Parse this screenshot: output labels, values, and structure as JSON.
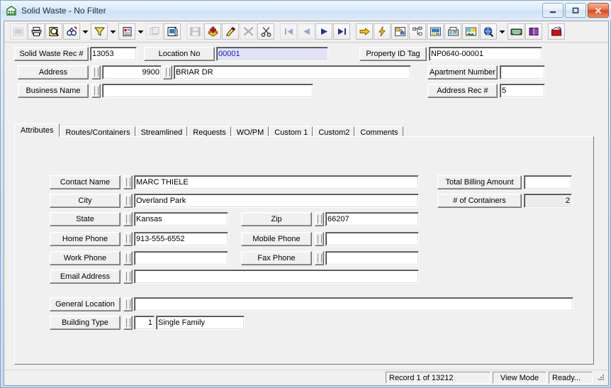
{
  "window": {
    "title": "Solid Waste - No Filter",
    "icon": "building-icon",
    "controls": {
      "minimize": "Minimize",
      "maximize": "Maximize",
      "close": "Close"
    }
  },
  "toolbar": {
    "buttons": [
      {
        "name": "grid-view-icon",
        "tooltip": "Grid View",
        "disabled": true
      },
      {
        "name": "print-icon",
        "tooltip": "Print",
        "disabled": false
      },
      {
        "name": "print-preview-icon",
        "tooltip": "Print Preview",
        "disabled": false
      },
      {
        "name": "find-icon",
        "tooltip": "Find",
        "disabled": false
      },
      {
        "name": "find-dropdown-icon",
        "tooltip": "Find Options",
        "disabled": false
      },
      {
        "name": "filter-icon",
        "tooltip": "Filter",
        "disabled": false
      },
      {
        "name": "filter-dropdown-icon",
        "tooltip": "Filter Options",
        "disabled": false
      },
      {
        "name": "report-icon",
        "tooltip": "Reports",
        "disabled": false
      },
      {
        "name": "report-dropdown-icon",
        "tooltip": "Report Options",
        "disabled": false
      },
      {
        "name": "properties-icon",
        "tooltip": "Properties",
        "disabled": true
      },
      {
        "name": "refresh-icon",
        "tooltip": "Refresh",
        "disabled": false
      },
      {
        "name": "save-icon",
        "tooltip": "Save",
        "disabled": true
      },
      {
        "name": "add-record-icon",
        "tooltip": "Add Record",
        "disabled": false
      },
      {
        "name": "edit-record-icon",
        "tooltip": "Edit Record",
        "disabled": false
      },
      {
        "name": "delete-record-icon",
        "tooltip": "Delete Record",
        "disabled": true
      },
      {
        "name": "cut-icon",
        "tooltip": "Cut",
        "disabled": false
      },
      {
        "name": "first-record-icon",
        "tooltip": "First Record",
        "disabled": true
      },
      {
        "name": "previous-record-icon",
        "tooltip": "Previous Record",
        "disabled": true
      },
      {
        "name": "next-record-icon",
        "tooltip": "Next Record",
        "disabled": false
      },
      {
        "name": "last-record-icon",
        "tooltip": "Last Record",
        "disabled": false
      },
      {
        "name": "go-to-icon",
        "tooltip": "Go To",
        "disabled": false
      },
      {
        "name": "quick-action-icon",
        "tooltip": "Quick Action",
        "disabled": false
      },
      {
        "name": "workflow-icon",
        "tooltip": "Workflow",
        "disabled": false
      },
      {
        "name": "hierarchy-icon",
        "tooltip": "Hierarchy",
        "disabled": false
      },
      {
        "name": "screen-icon",
        "tooltip": "Screen",
        "disabled": false
      },
      {
        "name": "fax-icon",
        "tooltip": "Fax",
        "disabled": false
      },
      {
        "name": "image-icon",
        "tooltip": "Image",
        "disabled": false
      },
      {
        "name": "globe-search-icon",
        "tooltip": "Web Search",
        "disabled": false
      },
      {
        "name": "globe-dropdown-icon",
        "tooltip": "Web Options",
        "disabled": false
      },
      {
        "name": "keyboard-icon",
        "tooltip": "Keyboard",
        "disabled": false
      },
      {
        "name": "help-book-icon",
        "tooltip": "Help",
        "disabled": false
      },
      {
        "name": "exit-icon",
        "tooltip": "Exit",
        "disabled": false
      }
    ]
  },
  "header": {
    "rec_no_label": "Solid Waste Rec #",
    "rec_no_value": "13053",
    "location_no_label": "Location No",
    "location_no_value": "00001",
    "property_id_label": "Property ID Tag",
    "property_id_value": "NP0640-00001",
    "address_label": "Address",
    "address_number": "9900",
    "address_street": "BRIAR DR",
    "apartment_label": "Apartment Number",
    "apartment_value": "",
    "business_name_label": "Business Name",
    "business_name_value": "",
    "address_rec_label": "Address Rec #",
    "address_rec_value": "5"
  },
  "tabs": [
    {
      "label": "Attributes",
      "active": true
    },
    {
      "label": "Routes/Containers",
      "active": false
    },
    {
      "label": "Streamlined",
      "active": false
    },
    {
      "label": "Requests",
      "active": false
    },
    {
      "label": "WO/PM",
      "active": false
    },
    {
      "label": "Custom 1",
      "active": false
    },
    {
      "label": "Custom2",
      "active": false
    },
    {
      "label": "Comments",
      "active": false
    }
  ],
  "attributes": {
    "contact_name_label": "Contact Name",
    "contact_name_value": "MARC THIELE",
    "city_label": "City",
    "city_value": "Overland Park",
    "state_label": "State",
    "state_value": "Kansas",
    "zip_label": "Zip",
    "zip_value": "66207",
    "home_phone_label": "Home Phone",
    "home_phone_value": "913-555-6552",
    "mobile_phone_label": "Mobile Phone",
    "mobile_phone_value": "",
    "work_phone_label": "Work Phone",
    "work_phone_value": "",
    "fax_phone_label": "Fax Phone",
    "fax_phone_value": "",
    "email_label": "Email Address",
    "email_value": "",
    "general_location_label": "General Location",
    "general_location_value": "",
    "building_type_label": "Building Type",
    "building_type_code": "1",
    "building_type_value": "Single Family",
    "total_billing_label": "Total Billing Amount",
    "total_billing_value": "",
    "containers_label": "# of Containers",
    "containers_value": "2"
  },
  "status": {
    "record": "Record 1 of 13212",
    "mode": "View Mode",
    "state": "Ready..."
  },
  "colors": {
    "focus_text": "#1414c8",
    "focus_bg": "#e2e2f7",
    "face": "#f0f0f0"
  }
}
